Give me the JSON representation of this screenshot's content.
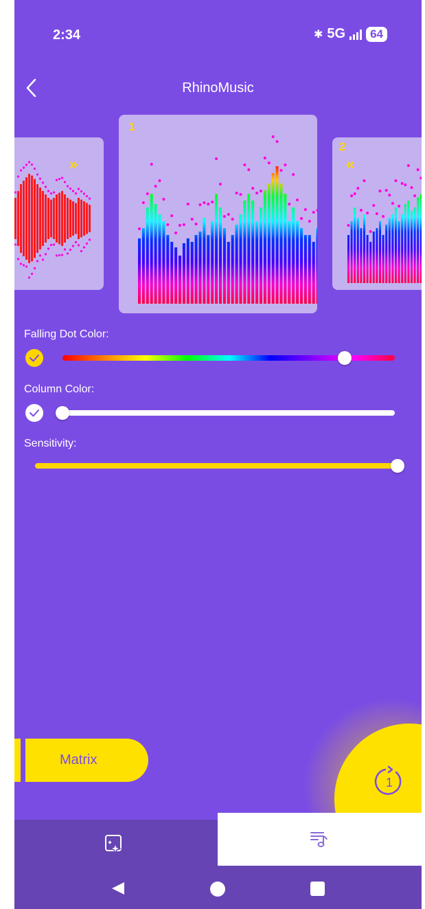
{
  "status": {
    "time": "2:34",
    "network": "5G",
    "battery": "64",
    "bluetooth_icon": "bluetooth-icon",
    "signal_icon": "signal-icon"
  },
  "header": {
    "title": "RhinoMusic",
    "back_icon": "chevron-left-icon"
  },
  "carousel": {
    "cards": [
      {
        "id": "prev",
        "number": "",
        "style": "mirrored red waveform with magenta dots",
        "chevron": "»"
      },
      {
        "id": "current",
        "number": "1",
        "style": "rainbow spectrum bars with falling dots"
      },
      {
        "id": "next",
        "number": "2",
        "style": "rainbow spectrum bars with falling dots",
        "chevron": "«"
      }
    ]
  },
  "controls": {
    "falling_dot_color": {
      "label": "Falling Dot Color:",
      "checked": true,
      "value_fraction": 0.85
    },
    "column_color": {
      "label": "Column Color:",
      "checked": true,
      "value_fraction": 0.0
    },
    "sensitivity": {
      "label": "Sensitivity:",
      "value_fraction": 1.0
    }
  },
  "mode_button": {
    "label": "Matrix"
  },
  "fab": {
    "icon": "rotate-one-icon",
    "badge": "1"
  },
  "tabs": [
    {
      "icon": "sparkle-image-icon",
      "active": false
    },
    {
      "icon": "music-list-icon",
      "active": true
    }
  ],
  "navbar": {
    "back_icon": "nav-back-icon",
    "home_icon": "nav-home-icon",
    "recents_icon": "nav-recents-icon"
  },
  "colors": {
    "background": "#7b4ce4",
    "accent": "#ffe100",
    "tabbar": "#6644b3",
    "card": "#c4b1f0"
  }
}
